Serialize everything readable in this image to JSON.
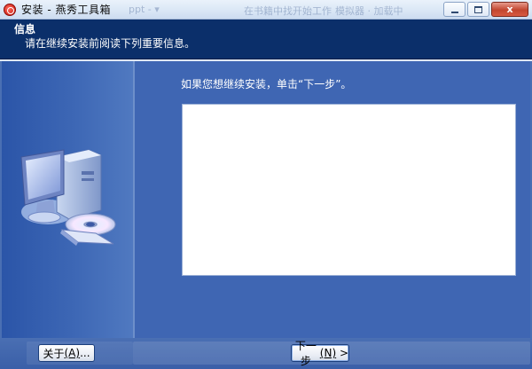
{
  "window": {
    "title": "安装 - 燕秀工具箱",
    "ghost_texts": [
      "ppt - ▾",
      "在书籍中找开始工作",
      "模拟器 · 加载中"
    ],
    "minimize_label": "",
    "maximize_label": "",
    "close_label": "x"
  },
  "header": {
    "title": "信息",
    "subtitle": "请在继续安装前阅读下列重要信息。"
  },
  "main": {
    "instruction": "如果您想继续安装，单击“下一步”。",
    "info_text": ""
  },
  "buttons": {
    "about": {
      "text": "关于",
      "accel": "(A)",
      "suffix": "..."
    },
    "next": {
      "text": "下一步",
      "accel": "(N)",
      "suffix": " >"
    }
  },
  "colors": {
    "header_bg": "#0b2f6a",
    "panel_bg": "#3f66b3",
    "info_bg": "#ffffff"
  },
  "icons": [
    "app-icon",
    "computer-setup-icon",
    "cd-disc-icon"
  ]
}
